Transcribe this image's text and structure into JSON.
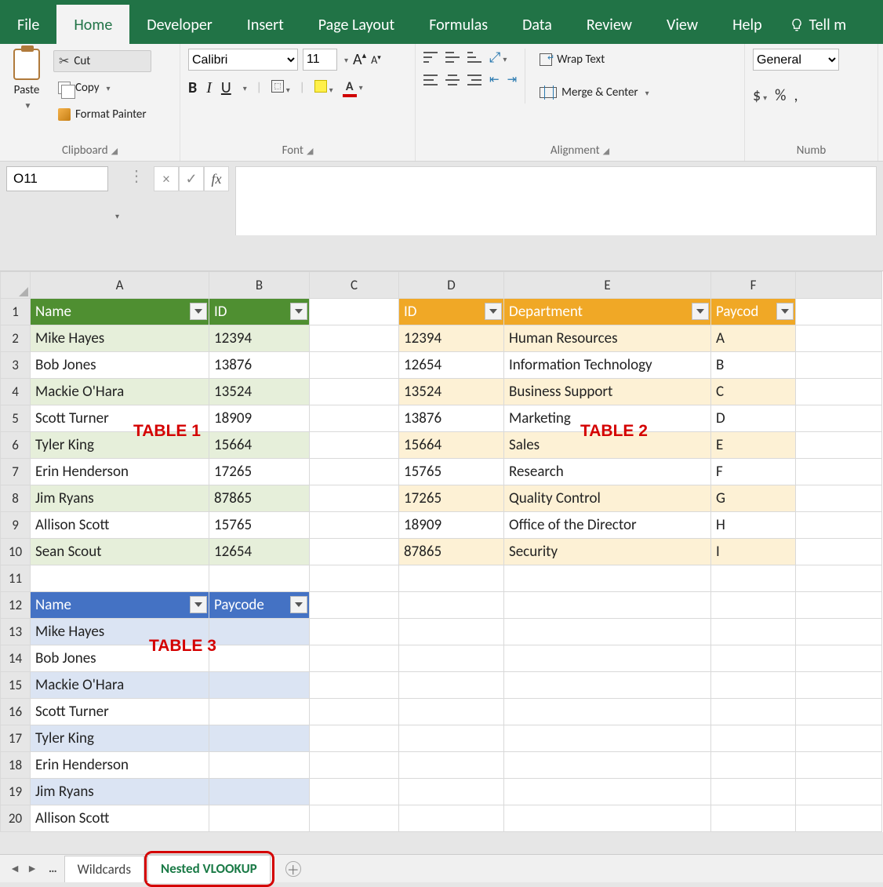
{
  "tabs": {
    "file": "File",
    "home": "Home",
    "developer": "Developer",
    "insert": "Insert",
    "pagelayout": "Page Layout",
    "formulas": "Formulas",
    "data": "Data",
    "review": "Review",
    "view": "View",
    "help": "Help",
    "tell": "Tell m"
  },
  "clipboard": {
    "paste": "Paste",
    "cut": "Cut",
    "copy": "Copy",
    "painter": "Format Painter",
    "group": "Clipboard"
  },
  "font": {
    "name": "Calibri",
    "size": "11",
    "group": "Font",
    "b": "B",
    "i": "I",
    "u": "U",
    "a": "A"
  },
  "alignment": {
    "wrap": "Wrap Text",
    "merge": "Merge & Center",
    "group": "Alignment"
  },
  "number": {
    "format": "General",
    "group": "Numb",
    "dollar": "$",
    "percent": "%",
    "comma": ","
  },
  "namebox": "O11",
  "formula": "",
  "columns": [
    "A",
    "B",
    "C",
    "D",
    "E",
    "F"
  ],
  "icons": {
    "fx": "fx",
    "check": "✓",
    "x": "×"
  },
  "annots": {
    "t1": "TABLE 1",
    "t2": "TABLE 2",
    "t3": "TABLE 3"
  },
  "table1": {
    "headers": {
      "name": "Name",
      "id": "ID"
    },
    "rows": [
      {
        "name": "Mike Hayes",
        "id": 12394
      },
      {
        "name": "Bob Jones",
        "id": 13876
      },
      {
        "name": "Mackie O'Hara",
        "id": 13524
      },
      {
        "name": "Scott Turner",
        "id": 18909
      },
      {
        "name": "Tyler King",
        "id": 15664
      },
      {
        "name": "Erin Henderson",
        "id": 17265
      },
      {
        "name": "Jim Ryans",
        "id": 87865
      },
      {
        "name": "Allison Scott",
        "id": 15765
      },
      {
        "name": "Sean Scout",
        "id": 12654
      }
    ]
  },
  "table2": {
    "headers": {
      "id": "ID",
      "dept": "Department",
      "paycode": "Paycod"
    },
    "rows": [
      {
        "id": 12394,
        "dept": "Human Resources",
        "pc": "A"
      },
      {
        "id": 12654,
        "dept": "Information Technology",
        "pc": "B"
      },
      {
        "id": 13524,
        "dept": "Business Support",
        "pc": "C"
      },
      {
        "id": 13876,
        "dept": "Marketing",
        "pc": "D"
      },
      {
        "id": 15664,
        "dept": "Sales",
        "pc": "E"
      },
      {
        "id": 15765,
        "dept": "Research",
        "pc": "F"
      },
      {
        "id": 17265,
        "dept": "Quality Control",
        "pc": "G"
      },
      {
        "id": 18909,
        "dept": "Office of the Director",
        "pc": "H"
      },
      {
        "id": 87865,
        "dept": "Security",
        "pc": "I"
      }
    ]
  },
  "table3": {
    "headers": {
      "name": "Name",
      "paycode": "Paycode"
    },
    "rows": [
      {
        "name": "Mike Hayes"
      },
      {
        "name": "Bob Jones"
      },
      {
        "name": "Mackie O'Hara"
      },
      {
        "name": "Scott Turner"
      },
      {
        "name": "Tyler King"
      },
      {
        "name": "Erin Henderson"
      },
      {
        "name": "Jim Ryans"
      },
      {
        "name": "Allison Scott"
      }
    ]
  },
  "sheets": {
    "wildcards": "Wildcards",
    "nested": "Nested VLOOKUP"
  }
}
